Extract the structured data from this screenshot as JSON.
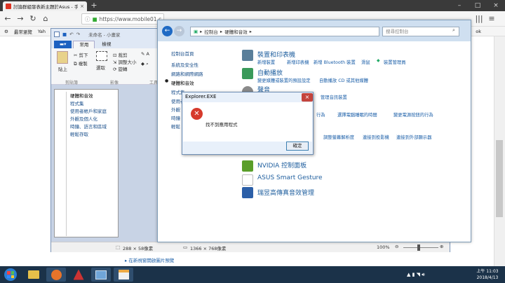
{
  "browser": {
    "tab_title": "討論群組發表新主題於Asus - 手機",
    "url": "https://www.mobile01.c",
    "bookmarks": [
      "最常瀏覽",
      "Yah"
    ],
    "bookmark_right": "ok"
  },
  "page": {
    "link_text": "▸ 在新視窗開啟圖片預覽"
  },
  "paint": {
    "title": "未命名 - 小畫家",
    "file_tab": "",
    "tab_home": "常用",
    "tab_view": "檢視",
    "cut": "剪下",
    "copy": "複製",
    "paste": "貼上",
    "crop": "裁剪",
    "resize": "調整大小",
    "rotate": "旋轉",
    "select": "選取",
    "clipboard_group": "剪貼簿",
    "image_group": "影像",
    "tools_group": "工具",
    "status_selection": "288 × 58像素",
    "status_size": "1366 × 768像素",
    "zoom": "100%"
  },
  "paint_sidebar_items": [
    "硬體和音效",
    "程式集",
    "使用者帳戶和家庭",
    "外觀及個人化",
    "時鐘、語言和區域",
    "輕鬆存取"
  ],
  "control_panel": {
    "breadcrumb_1": "控制台",
    "breadcrumb_2": "硬體和音效",
    "search_placeholder": "搜尋控制台",
    "nav": [
      "控制台首頁",
      "系統及安全性",
      "網路和網際網路",
      "硬體和音效",
      "程式集",
      "使用者",
      "外觀",
      "時鐘",
      "輕鬆"
    ],
    "devices": {
      "heading": "裝置和印表機",
      "links": [
        "新增裝置",
        "新增印表機",
        "新增 Bluetooth 裝置",
        "滑鼠",
        "裝置管理員"
      ]
    },
    "autoplay": {
      "heading": "自動播放",
      "links": [
        "變更媒體或裝置的預設設定",
        "自動播放 CD 或其他媒體"
      ]
    },
    "sound": {
      "heading": "聲音",
      "links": [
        "管理音訊裝置"
      ]
    },
    "power_links": [
      "行為",
      "選擇電腦睡眠的時間",
      "變更電源按鈕的行為"
    ],
    "display_links": [
      "調整螢幕解析度",
      "連接到投影機",
      "連接到外部顯示器"
    ],
    "nvidia": "NVIDIA 控制面板",
    "asus": "ASUS Smart Gesture",
    "realtek": "瑞昱高傳真音效管理"
  },
  "dialog": {
    "title": "Explorer.EXE",
    "message": "找不到應用程式",
    "ok": "確定",
    "close": "×"
  },
  "taskbar": {
    "time": "上午 11:03",
    "date": "2018/4/13"
  },
  "colors": {
    "taskbar": "#1b3249",
    "paint_file_tab": "#1c61c0",
    "error_red": "#d63a2c",
    "link_blue": "#1a5ea8"
  }
}
